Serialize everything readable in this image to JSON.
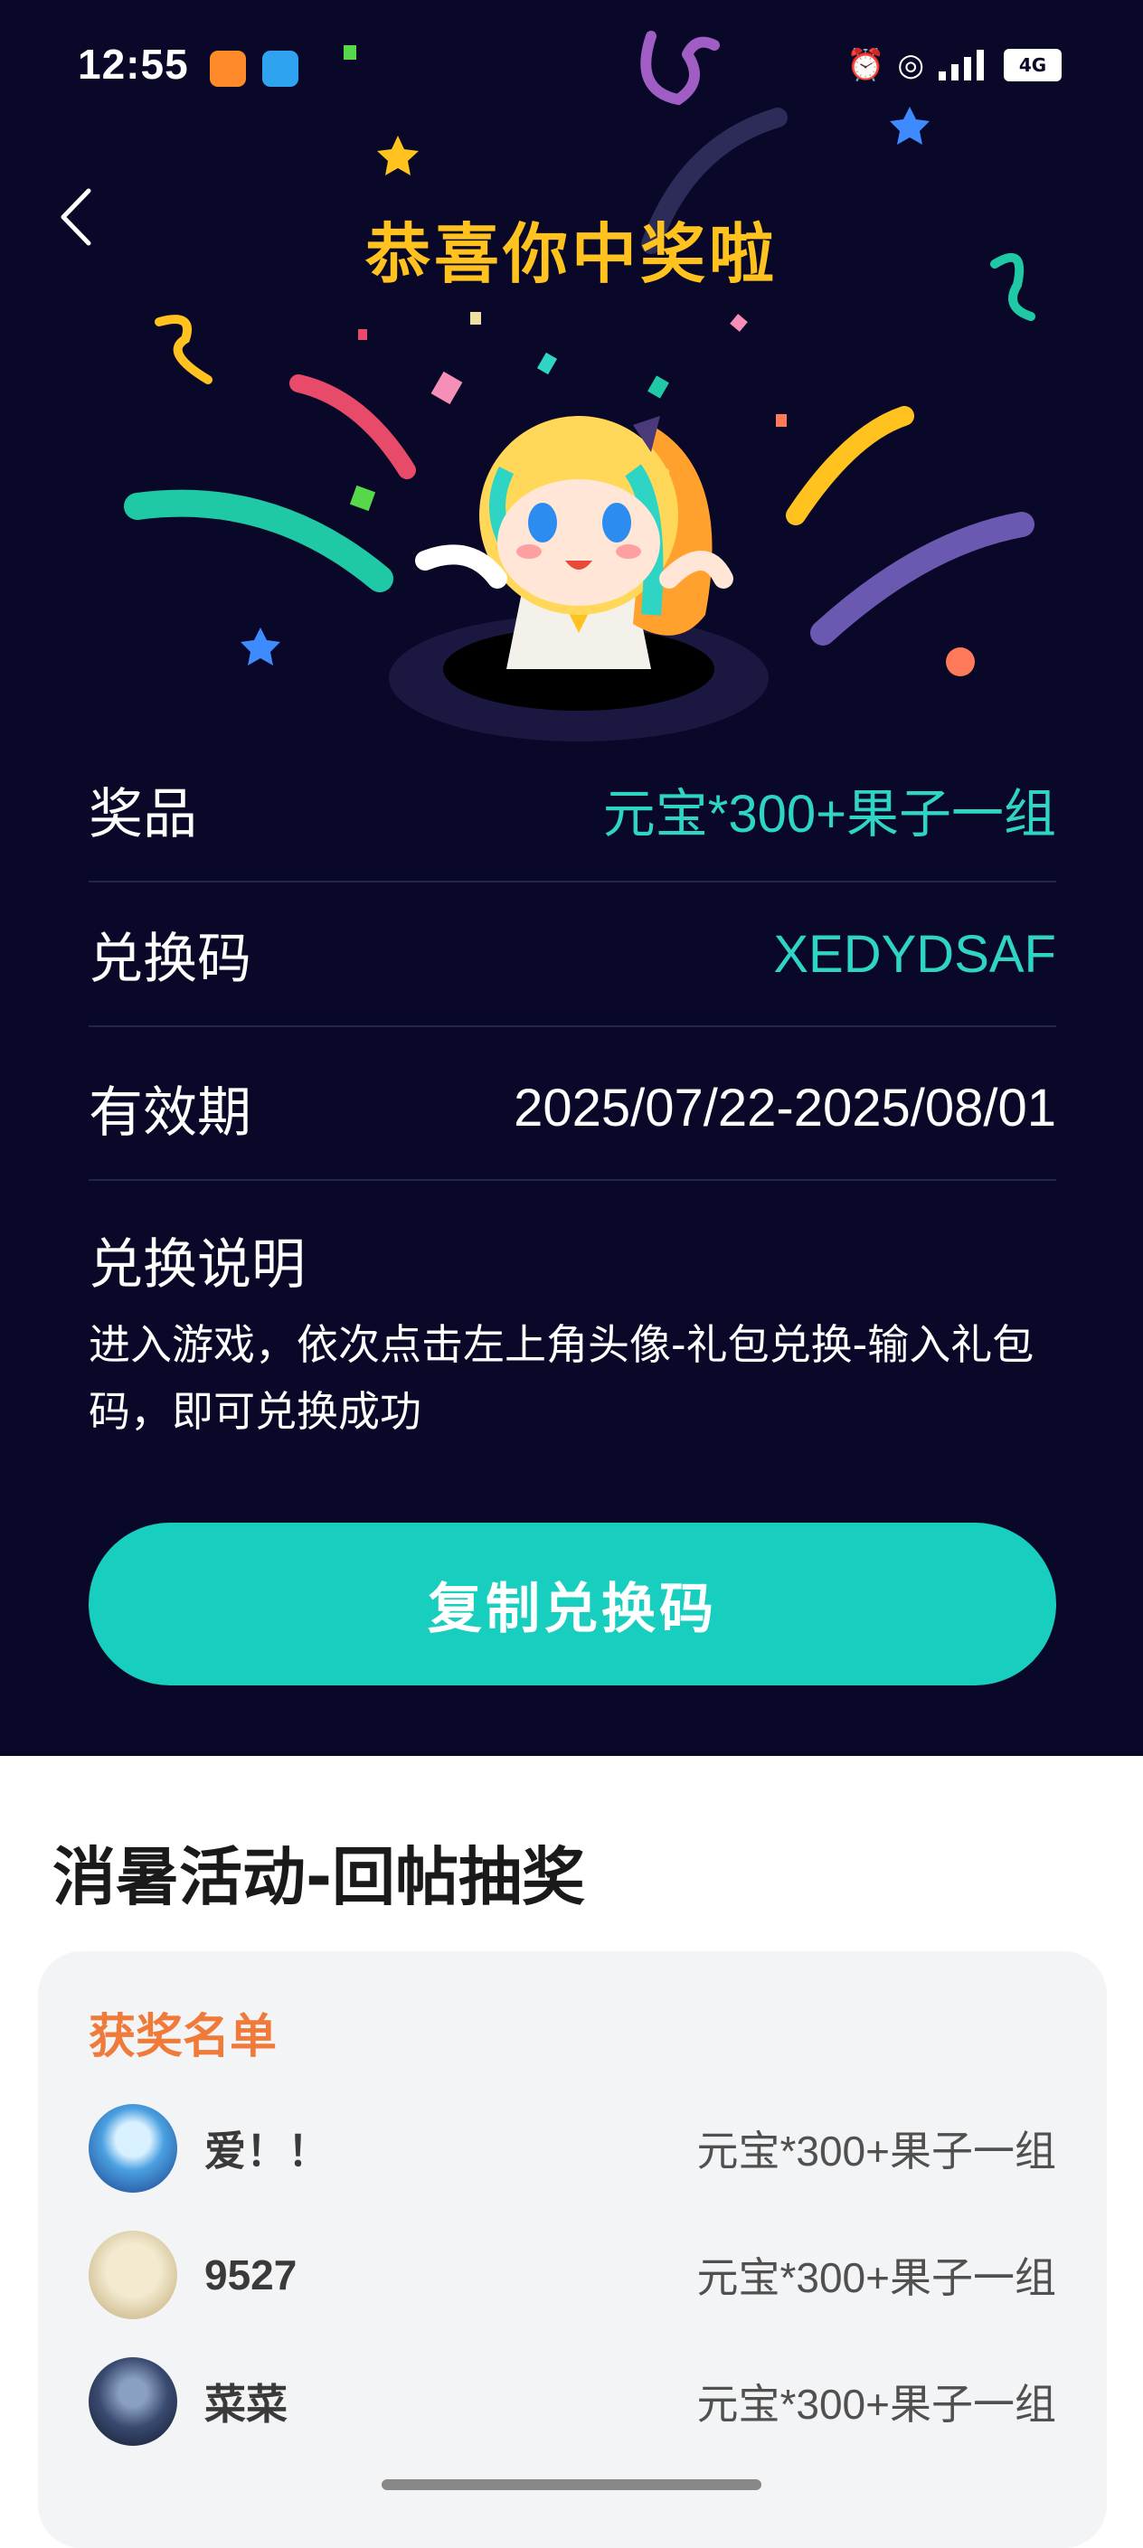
{
  "status_bar": {
    "time": "12:55",
    "network": "4G",
    "icons": [
      "app-icon-orange",
      "app-icon-blue",
      "alarm-icon",
      "nfc-icon",
      "signal-icon",
      "battery-icon"
    ]
  },
  "header": {
    "title": "恭喜你中奖啦"
  },
  "prize_info": {
    "prize_label": "奖品",
    "prize_value": "元宝*300+果子一组",
    "code_label": "兑换码",
    "code_value": "XEDYDSAF",
    "validity_label": "有效期",
    "validity_value": "2025/07/22-2025/08/01",
    "instructions_title": "兑换说明",
    "instructions_body": "进入游戏，依次点击左上角头像-礼包兑换-输入礼包码，即可兑换成功"
  },
  "copy_button": {
    "label": "复制兑换码"
  },
  "event": {
    "title": "消暑活动-回帖抽奖",
    "winners_heading": "获奖名单",
    "winners": [
      {
        "name": "爱！！",
        "prize": "元宝*300+果子一组"
      },
      {
        "name": "9527",
        "prize": "元宝*300+果子一组"
      },
      {
        "name": "菜菜",
        "prize": "元宝*300+果子一组"
      }
    ]
  },
  "colors": {
    "background_dark": "#0a0828",
    "title_yellow": "#ffc21f",
    "teal_accent": "#2ed5c5",
    "button_teal": "#18cfbf",
    "winners_orange": "#f07a3a"
  }
}
